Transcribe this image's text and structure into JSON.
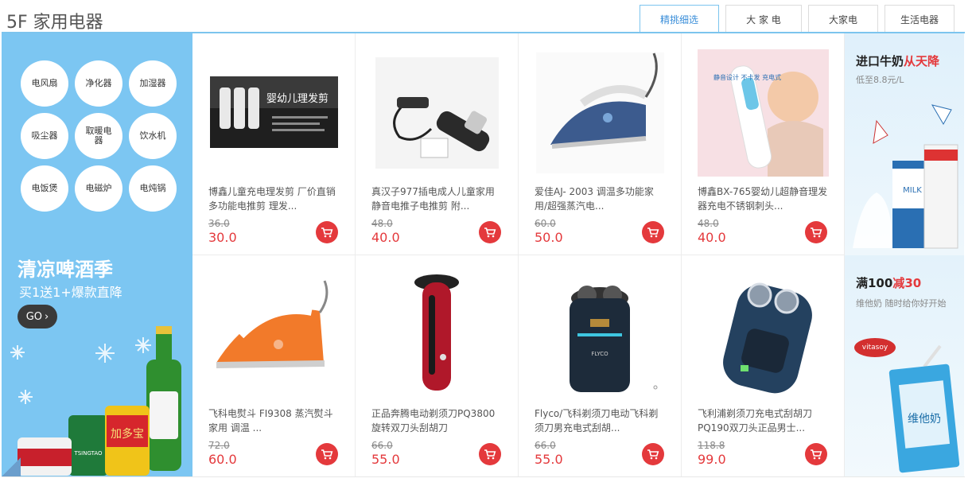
{
  "floor": {
    "title": "5F 家用电器"
  },
  "tabs": [
    {
      "label": "精挑细选"
    },
    {
      "label": "大 家 电"
    },
    {
      "label": "大家电"
    },
    {
      "label": "生活电器"
    }
  ],
  "categories": [
    "电风扇",
    "净化器",
    "加湿器",
    "吸尘器",
    "取暖电器",
    "饮水机",
    "电饭煲",
    "电磁炉",
    "电炖锅"
  ],
  "promo": {
    "title": "清凉啤酒季",
    "subtitle": "买1送1+爆款直降",
    "go_label": "GO",
    "bottle_label": "加多宝",
    "can_label": "TSINGTAO"
  },
  "products": [
    {
      "name": "博鑫儿童充电理发剪 厂价直销 多功能电推剪 理发...",
      "old_price": "36.0",
      "price": "30.0",
      "image_text": "婴幼儿理发剪"
    },
    {
      "name": "真汉子977插电成人儿童家用静音电推子电推剪 附...",
      "old_price": "48.0",
      "price": "40.0"
    },
    {
      "name": "爱佳AJ- 2003 调温多功能家用/超强蒸汽电...",
      "old_price": "60.0",
      "price": "50.0"
    },
    {
      "name": "博鑫BX-765婴幼儿超静音理发器充电不锈钢刺头...",
      "old_price": "48.0",
      "price": "40.0",
      "image_text": "静音设计 不卡发 充电式"
    },
    {
      "name": "飞科电熨斗 FI9308 蒸汽熨斗 家用 调温 ...",
      "old_price": "72.0",
      "price": "60.0"
    },
    {
      "name": "正品奔腾电动剃须刀PQ3800旋转双刀头刮胡刀",
      "old_price": "66.0",
      "price": "55.0"
    },
    {
      "name": "Flyco/飞科剃须刀电动飞科剃须刀男充电式刮胡...",
      "old_price": "66.0",
      "price": "55.0",
      "image_text": "FLYCO"
    },
    {
      "name": "飞利浦剃须刀充电式刮胡刀PQ190双刀头正品男士...",
      "old_price": "118.8",
      "price": "99.0"
    }
  ],
  "ads": [
    {
      "title_black": "进口牛奶",
      "title_red": "从天降",
      "subtitle": "低至8.8元/L",
      "carton_text": "MILK"
    },
    {
      "title_black": "满100",
      "title_red": "减30",
      "subtitle": "维他奶 随时给你好开始",
      "brand": "vitasoy",
      "carton_text": "维他奶"
    }
  ],
  "colors": {
    "accent": "#7cc4ee",
    "price": "#e4393c",
    "left_panel": "#7cc6f2"
  }
}
